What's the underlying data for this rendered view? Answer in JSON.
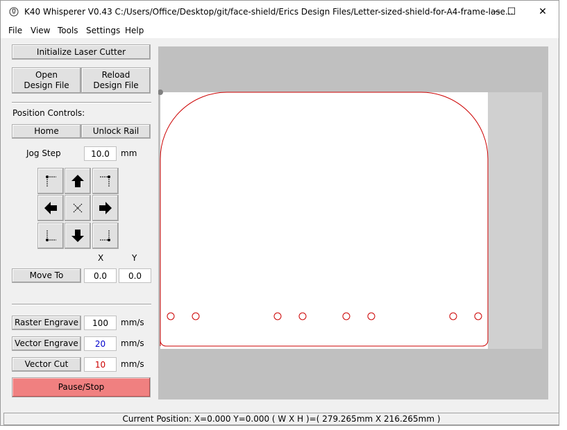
{
  "window": {
    "title": "K40 Whisperer V0.43   C:/Users/Office/Desktop/git/face-shield/Erics Design Files/Letter-sized-shield-for-A4-frame-lase...",
    "minimize": "—",
    "maximize": "☐",
    "close": "✕"
  },
  "menu": [
    "File",
    "View",
    "Tools",
    "Settings",
    "Help"
  ],
  "controls": {
    "init": "Initialize Laser Cutter",
    "open": "Open\nDesign File",
    "reload": "Reload\nDesign File",
    "position_controls": "Position Controls:",
    "home": "Home",
    "unlock": "Unlock Rail",
    "jog_step_label": "Jog Step",
    "jog_step_value": "10.0",
    "jog_unit": "mm",
    "x_label": "X",
    "y_label": "Y",
    "move_to": "Move To",
    "x_value": "0.0",
    "y_value": "0.0",
    "raster_engrave": "Raster Engrave",
    "raster_value": "100",
    "vector_engrave": "Vector Engrave",
    "vector_engrave_value": "20",
    "vector_cut": "Vector Cut",
    "vector_cut_value": "10",
    "speed_unit": "mm/s",
    "pause_stop": "Pause/Stop"
  },
  "colors": {
    "raster": "#000000",
    "vector_engrave": "#0000cc",
    "vector_cut": "#cc0000",
    "pause_bg": "#f08080",
    "cut_path": "#cc0000"
  },
  "status": {
    "text": "Current Position: X=0.000 Y=0.000    ( W X H )=( 279.265mm X 216.265mm )"
  }
}
